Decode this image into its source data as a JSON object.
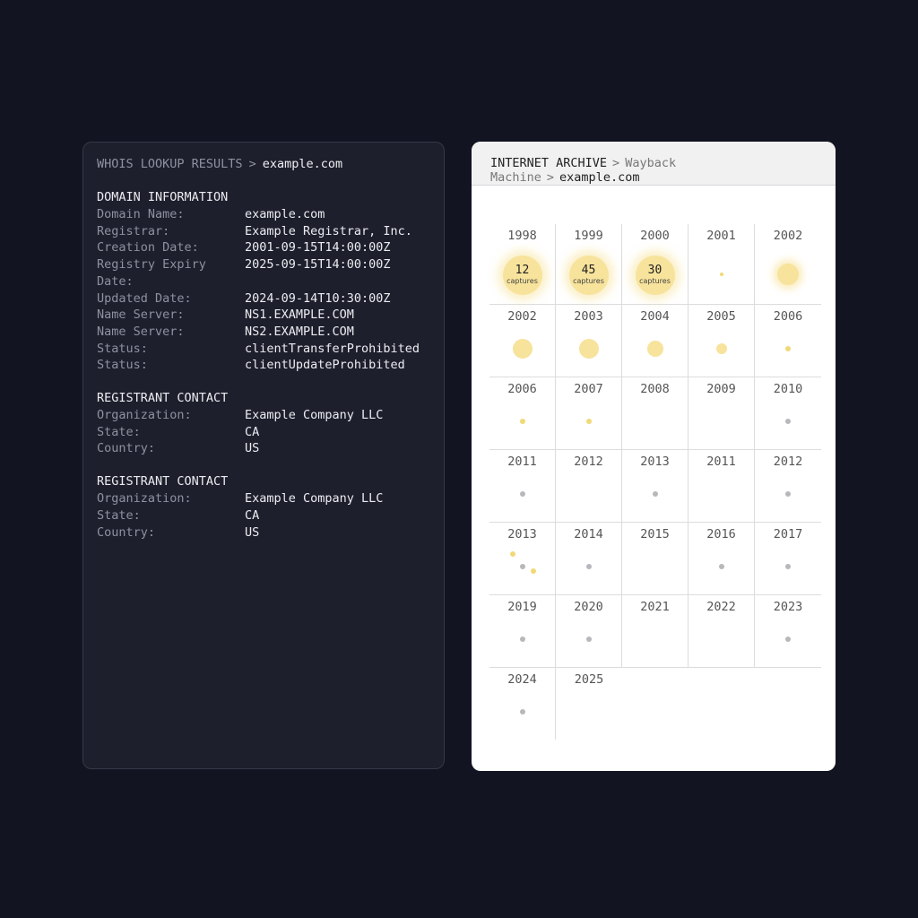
{
  "whois": {
    "breadcrumb": {
      "root": "WHOIS LOOKUP RESULTS",
      "separator": ">",
      "current": "example.com"
    },
    "sections": [
      {
        "title": "DOMAIN INFORMATION",
        "rows": [
          {
            "label": "Domain Name:",
            "value": "example.com"
          },
          {
            "label": "Registrar:",
            "value": "Example Registrar, Inc."
          },
          {
            "label": "Creation Date:",
            "value": "2001-09-15T14:00:00Z"
          },
          {
            "label": "Registry Expiry Date:",
            "value": "2025-09-15T14:00:00Z"
          },
          {
            "label": "Updated Date:",
            "value": "2024-09-14T10:30:00Z"
          },
          {
            "label": "Name Server:",
            "value": "NS1.EXAMPLE.COM"
          },
          {
            "label": "Name Server:",
            "value": "NS2.EXAMPLE.COM"
          },
          {
            "label": "Status:",
            "value": "clientTransferProhibited"
          },
          {
            "label": "Status:",
            "value": "clientUpdateProhibited"
          }
        ]
      },
      {
        "title": "REGISTRANT CONTACT",
        "rows": [
          {
            "label": "Organization:",
            "value": "Example Company LLC"
          },
          {
            "label": "State:",
            "value": "CA"
          },
          {
            "label": "Country:",
            "value": "US"
          }
        ]
      },
      {
        "title": "REGISTRANT CONTACT",
        "rows": [
          {
            "label": "Organization:",
            "value": "Example Company LLC"
          },
          {
            "label": "State:",
            "value": "CA"
          },
          {
            "label": "Country:",
            "value": "US"
          }
        ]
      }
    ]
  },
  "wayback": {
    "breadcrumb": {
      "root": "INTERNET ARCHIVE",
      "separator": ">",
      "middle": "Wayback Machine",
      "current": "example.com"
    },
    "colors": {
      "capture_yellow": "#f7e39b",
      "small_yellow": "#f1d977",
      "gray": "#b8b8bc"
    },
    "rows": [
      [
        {
          "year": "1998",
          "captures": "12",
          "captures_label": "captures"
        },
        {
          "year": "1999",
          "captures": "45",
          "captures_label": "captures"
        },
        {
          "year": "2000",
          "captures": "30",
          "captures_label": "captures"
        },
        {
          "year": "2001",
          "marks": [
            {
              "kind": "tiny-yellow"
            }
          ]
        },
        {
          "year": "2002",
          "marks": [
            {
              "kind": "glow"
            }
          ]
        }
      ],
      [
        {
          "year": "2002",
          "marks": [
            {
              "kind": "yellow-lg"
            }
          ]
        },
        {
          "year": "2003",
          "marks": [
            {
              "kind": "yellow-lg"
            }
          ]
        },
        {
          "year": "2004",
          "marks": [
            {
              "kind": "yellow-md"
            }
          ]
        },
        {
          "year": "2005",
          "marks": [
            {
              "kind": "yellow-sm"
            }
          ]
        },
        {
          "year": "2006",
          "marks": [
            {
              "kind": "yellow-xs"
            }
          ]
        }
      ],
      [
        {
          "year": "2006",
          "marks": [
            {
              "kind": "yellow-xs"
            }
          ]
        },
        {
          "year": "2007",
          "marks": [
            {
              "kind": "yellow-xs"
            }
          ]
        },
        {
          "year": "2008",
          "marks": []
        },
        {
          "year": "2009",
          "marks": []
        },
        {
          "year": "2010",
          "marks": [
            {
              "kind": "gray"
            }
          ]
        }
      ],
      [
        {
          "year": "2011",
          "marks": [
            {
              "kind": "gray"
            }
          ]
        },
        {
          "year": "2012",
          "marks": []
        },
        {
          "year": "2013",
          "marks": [
            {
              "kind": "gray"
            }
          ]
        },
        {
          "year": "2011",
          "marks": []
        },
        {
          "year": "2012",
          "marks": [
            {
              "kind": "gray"
            }
          ]
        }
      ],
      [
        {
          "year": "2013",
          "marks": [
            {
              "kind": "yellow-xs-a"
            },
            {
              "kind": "gray-b"
            },
            {
              "kind": "yellow-xs-c"
            }
          ]
        },
        {
          "year": "2014",
          "marks": [
            {
              "kind": "gray"
            }
          ]
        },
        {
          "year": "2015",
          "marks": []
        },
        {
          "year": "2016",
          "marks": [
            {
              "kind": "gray"
            }
          ]
        },
        {
          "year": "2017",
          "marks": [
            {
              "kind": "gray"
            }
          ]
        }
      ],
      [
        {
          "year": "2019",
          "marks": [
            {
              "kind": "gray"
            }
          ]
        },
        {
          "year": "2020",
          "marks": [
            {
              "kind": "gray"
            }
          ]
        },
        {
          "year": "2021",
          "marks": []
        },
        {
          "year": "2022",
          "marks": []
        },
        {
          "year": "2023",
          "marks": [
            {
              "kind": "gray"
            }
          ]
        }
      ],
      [
        {
          "year": "2024",
          "marks": [
            {
              "kind": "gray"
            }
          ]
        },
        {
          "year": "2025",
          "marks": []
        }
      ]
    ]
  }
}
